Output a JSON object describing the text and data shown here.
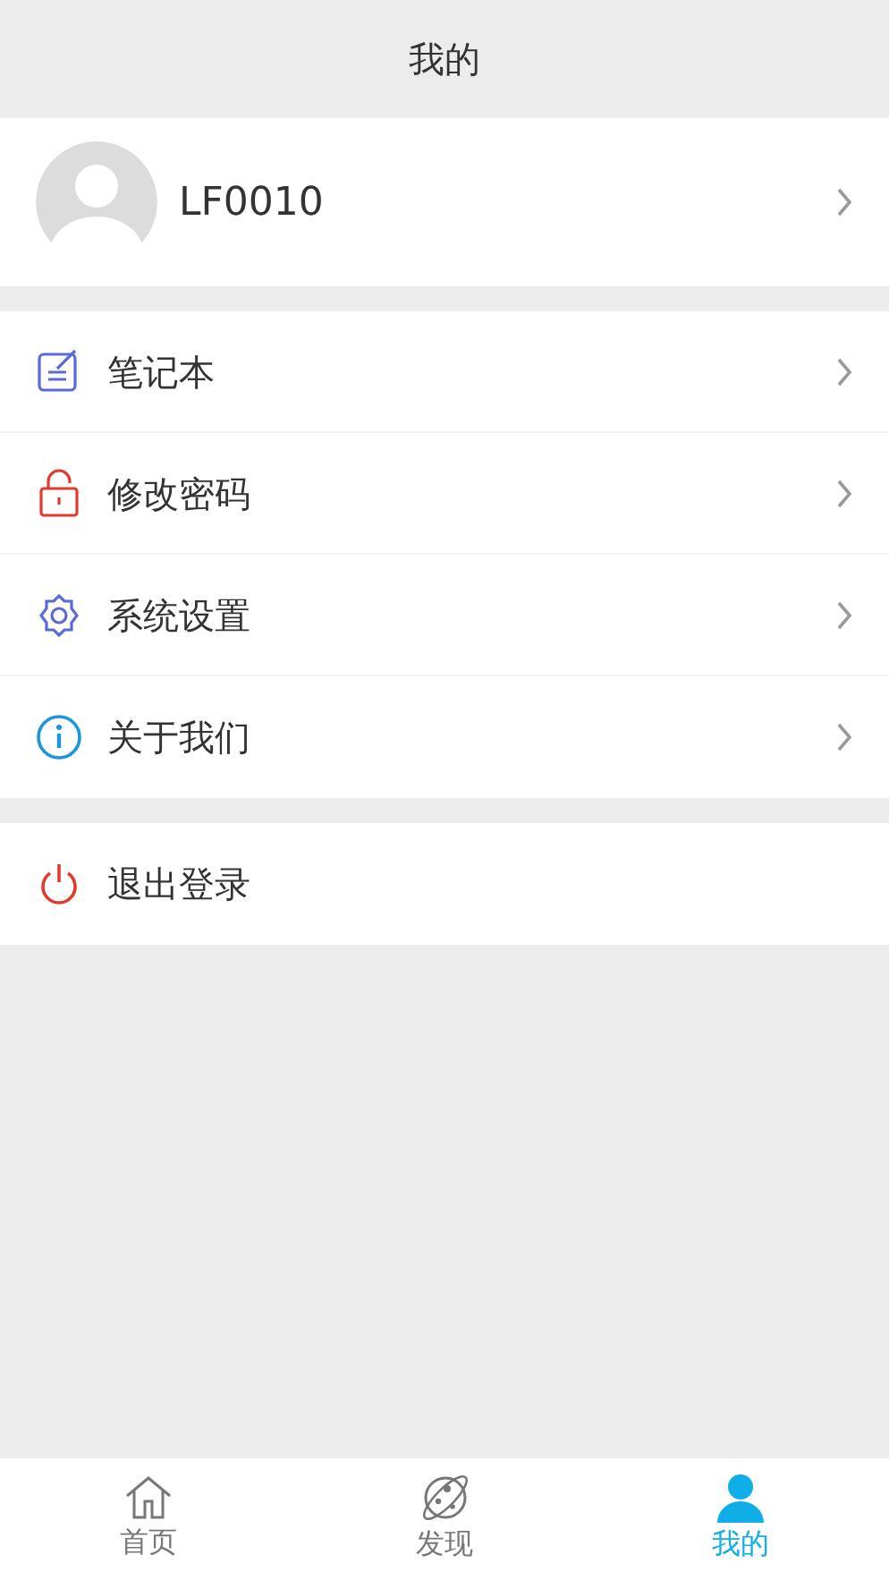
{
  "header": {
    "title": "我的"
  },
  "profile": {
    "username": "LF0010"
  },
  "menu": [
    {
      "label": "笔记本"
    },
    {
      "label": "修改密码"
    },
    {
      "label": "系统设置"
    },
    {
      "label": "关于我们"
    }
  ],
  "logout": {
    "label": "退出登录"
  },
  "tabs": [
    {
      "label": "首页",
      "selected": false
    },
    {
      "label": "发现",
      "selected": false
    },
    {
      "label": "我的",
      "selected": true
    }
  ]
}
